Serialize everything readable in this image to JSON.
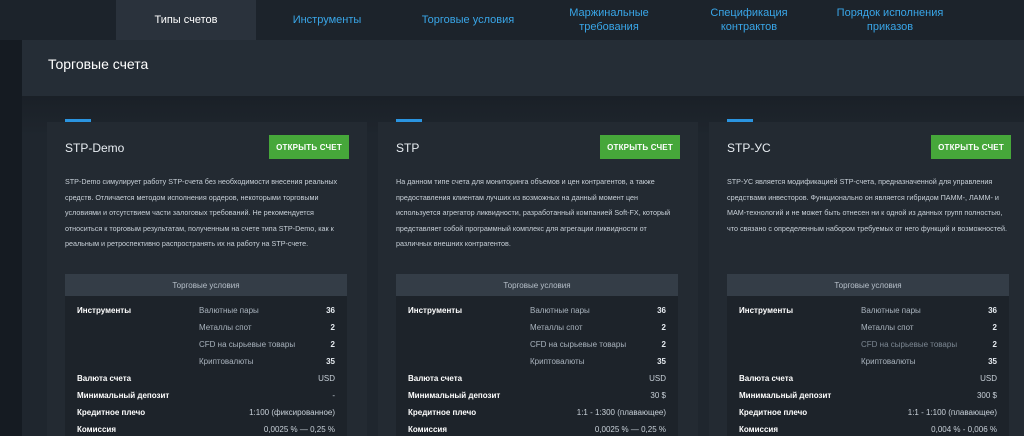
{
  "tabs": [
    {
      "label": "Типы счетов",
      "active": true
    },
    {
      "label": "Инструменты"
    },
    {
      "label": "Торговые условия"
    },
    {
      "label": "Маржинальные\nтребования"
    },
    {
      "label": "Спецификация\nконтрактов"
    },
    {
      "label": "Порядок исполнения\nприказов"
    }
  ],
  "panel": {
    "title": "Торговые счета"
  },
  "open_button_label": "ОТКРЫТЬ СЧЕТ",
  "cards": [
    {
      "title": "STP-Demo",
      "description": "STP-Demo симулирует работу STP-счета без необходимости внесения реальных средств. Отличается методом исполнения ордеров, некоторыми торговыми условиями и отсутствием части залоговых требований. Не рекомендуется относиться к торговым результатам, полученным на счете типа STP-Demo, как к реальным и ретроспективно распространять их на работу на STP-счете.",
      "conditions_header": "Торговые условия",
      "instruments_label": "Инструменты",
      "instruments": [
        {
          "name": "Валютные пары",
          "value": "36"
        },
        {
          "name": "Металлы спот",
          "value": "2"
        },
        {
          "name": "CFD на сырьевые товары",
          "value": "2"
        },
        {
          "name": "Криптовалюты",
          "value": "35"
        }
      ],
      "rows": [
        {
          "label": "Валюта счета",
          "value": "USD"
        },
        {
          "label": "Минимальный депозит",
          "value": "-"
        },
        {
          "label": "Кредитное плечо",
          "value": "1:100 (фиксированное)"
        },
        {
          "label": "Комиссия",
          "value": "0,0025 % — 0,25 %"
        }
      ]
    },
    {
      "title": "STP",
      "description": "На данном типе счета для мониторинга объемов и цен контрагентов, а также предоставления клиентам лучших из возможных на данный момент цен используется агрегатор ликвидности, разработанный компанией Soft-FX, который представляет собой программный комплекс для агрегации ликвидности от различных внешних контрагентов.",
      "conditions_header": "Торговые условия",
      "instruments_label": "Инструменты",
      "instruments": [
        {
          "name": "Валютные пары",
          "value": "36"
        },
        {
          "name": "Металлы спот",
          "value": "2"
        },
        {
          "name": "CFD на сырьевые товары",
          "value": "2"
        },
        {
          "name": "Криптовалюты",
          "value": "35"
        }
      ],
      "rows": [
        {
          "label": "Валюта счета",
          "value": "USD"
        },
        {
          "label": "Минимальный депозит",
          "value": "30 $"
        },
        {
          "label": "Кредитное плечо",
          "value": "1:1 - 1:300 (плавающее)"
        },
        {
          "label": "Комиссия",
          "value": "0,0025 % — 0,25 %"
        }
      ]
    },
    {
      "title": "STP-УС",
      "description": "STP-УС является модификацией STP-счета, предназначенной для управления средствами инвесторов. Функционально он является гибридом ПАММ-, ЛАММ- и МАМ-технологий и не может быть отнесен ни к одной из данных групп полностью, что связано с определенным набором требуемых от него функций и возможностей.",
      "conditions_header": "Торговые условия",
      "instruments_label": "Инструменты",
      "instruments": [
        {
          "name": "Валютные пары",
          "value": "36"
        },
        {
          "name": "Металлы спот",
          "value": "2"
        },
        {
          "name": "CFD на сырьевые товары",
          "value": "2",
          "dim": true
        },
        {
          "name": "Криптовалюты",
          "value": "35"
        }
      ],
      "rows": [
        {
          "label": "Валюта счета",
          "value": "USD"
        },
        {
          "label": "Минимальный депозит",
          "value": "300 $"
        },
        {
          "label": "Кредитное плечо",
          "value": "1:1 - 1:100 (плавающее)"
        },
        {
          "label": "Комиссия",
          "value": "0,004 % - 0,006 %"
        }
      ]
    }
  ]
}
